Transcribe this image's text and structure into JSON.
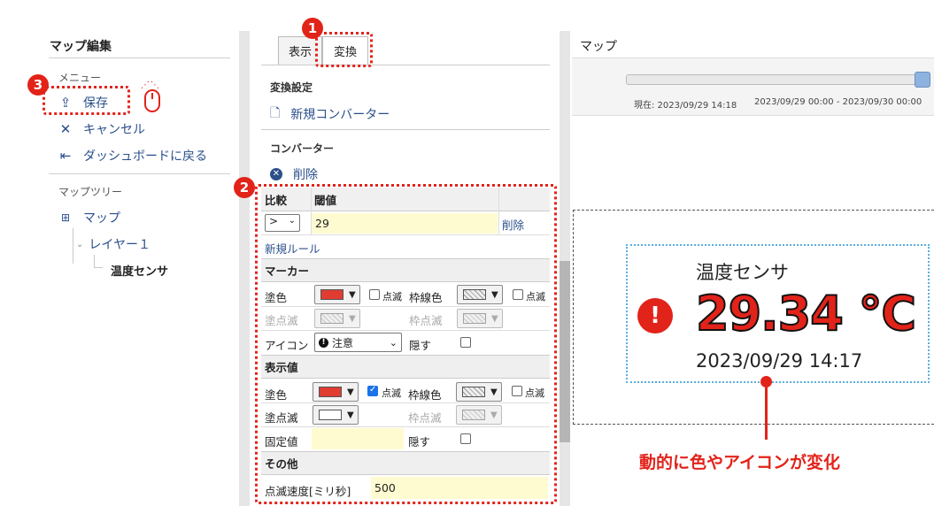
{
  "sidebar": {
    "title": "マップ編集",
    "menu_label": "メニュー",
    "save": "保存",
    "cancel": "キャンセル",
    "back": "ダッシュボードに戻る",
    "tree_label": "マップツリー",
    "tree_root": "マップ",
    "layer": "レイヤー１",
    "sensor": "温度センサ"
  },
  "middle": {
    "tabs": [
      "表示",
      "変換"
    ],
    "convert_settings": "変換設定",
    "new_converter": "新規コンバーター",
    "converter_label": "コンバーター",
    "delete": "削除",
    "rules": {
      "col_compare": "比較",
      "col_threshold": "閾値",
      "operator": ">",
      "threshold": "29",
      "row_delete": "削除",
      "new_rule": "新規ルール"
    },
    "marker": {
      "section": "マーカー",
      "fill": "塗色",
      "fill_color": "#e03c31",
      "blink": "点滅",
      "border_color": "枠線色",
      "fill_blink": "塗点滅",
      "border_blink": "枠点滅",
      "icon": "アイコン",
      "icon_value": "注意",
      "hide": "隠す"
    },
    "display_value": {
      "section": "表示値",
      "fill": "塗色",
      "fill_color": "#e03c31",
      "blink": "点滅",
      "border_color": "枠線色",
      "fill_blink": "塗点滅",
      "border_blink": "枠点滅",
      "fixed": "固定値",
      "hide": "隠す"
    },
    "other": {
      "section": "その他",
      "blink_speed": "点滅速度[ミリ秒]",
      "blink_speed_value": "500"
    }
  },
  "right": {
    "title": "マップ",
    "current": "現在: 2023/09/29 14:18",
    "range": "2023/09/29 00:00 - 2023/09/30 00:00",
    "widget_title": "温度センサ",
    "value": "29.34 ℃",
    "timestamp": "2023/09/29 14:17",
    "note": "動的に色やアイコンが変化"
  },
  "annotations": [
    "1",
    "2",
    "3"
  ],
  "colors": {
    "accent_red": "#e2231a",
    "link": "#2a4f8b"
  }
}
